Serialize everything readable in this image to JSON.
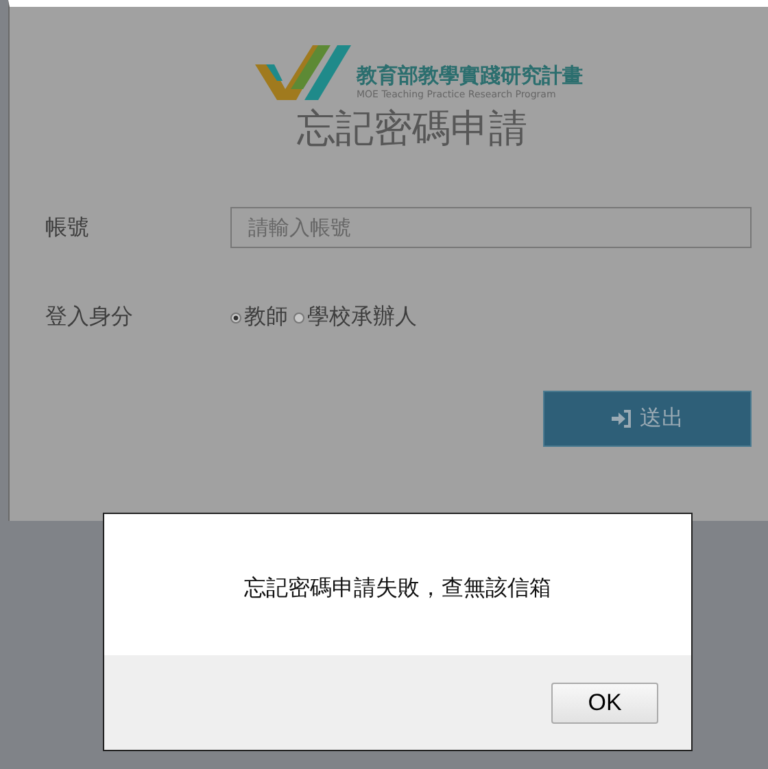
{
  "logo": {
    "title_zh": "教育部教學實踐研究計畫",
    "title_en": "MOE Teaching Practice Research Program"
  },
  "page_title": "忘記密碼申請",
  "account": {
    "label": "帳號",
    "placeholder": "請輸入帳號"
  },
  "role": {
    "label": "登入身分",
    "options": [
      {
        "label": "教師",
        "selected": true
      },
      {
        "label": "學校承辦人",
        "selected": false
      }
    ]
  },
  "submit_button": "送出",
  "dialog": {
    "message": "忘記密碼申請失敗，查無該信箱",
    "buttons": [
      "OK"
    ]
  }
}
